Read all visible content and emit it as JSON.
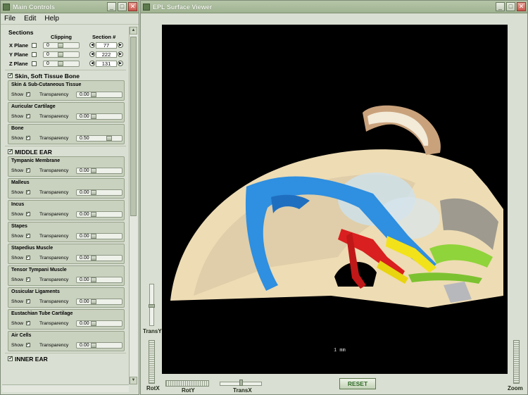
{
  "main_window": {
    "title": "Main Controls",
    "controls": {
      "minimize": "_",
      "maximize": "□",
      "close": "✕"
    },
    "menu": [
      "File",
      "Edit",
      "Help"
    ],
    "sections": {
      "header": "Sections",
      "col_clipping": "Clipping",
      "col_section": "Section #",
      "planes": [
        {
          "label": "X Plane",
          "clip": "0",
          "section": "77"
        },
        {
          "label": "Y Plane",
          "clip": "0",
          "section": "222"
        },
        {
          "label": "Z Plane",
          "clip": "0",
          "section": "131"
        }
      ]
    },
    "show_label": "Show",
    "transparency_label": "Transparency",
    "groups": [
      {
        "label": "Skin, Soft Tissue  Bone",
        "items": [
          {
            "name": "Skin & Sub-Cutaneous Tissue",
            "transparency": "0.00",
            "level": 0.0
          },
          {
            "name": "Auricular Cartilage",
            "transparency": "0.00",
            "level": 0.0
          },
          {
            "name": "Bone",
            "transparency": "0.50",
            "level": 0.5
          }
        ]
      },
      {
        "label": "MIDDLE EAR",
        "items": [
          {
            "name": "Tympanic Membrane",
            "transparency": "0.00",
            "level": 0.0
          },
          {
            "name": "Malleus",
            "transparency": "0.00",
            "level": 0.0
          },
          {
            "name": "Incus",
            "transparency": "0.00",
            "level": 0.0
          },
          {
            "name": "Stapes",
            "transparency": "0.00",
            "level": 0.0
          },
          {
            "name": "Stapedius Muscle",
            "transparency": "0.00",
            "level": 0.0
          },
          {
            "name": "Tensor Tympani Muscle",
            "transparency": "0.00",
            "level": 0.0
          },
          {
            "name": "Ossicular Ligaments",
            "transparency": "0.00",
            "level": 0.0
          },
          {
            "name": "Eustachian Tube Cartilage",
            "transparency": "0.00",
            "level": 0.0
          },
          {
            "name": "Air Cells",
            "transparency": "0.00",
            "level": 0.0
          }
        ]
      },
      {
        "label": "INNER EAR",
        "items": []
      }
    ]
  },
  "viewer_window": {
    "title": "EPL Surface Viewer",
    "controls": {
      "minimize": "_",
      "maximize": "□",
      "close": "✕"
    },
    "scale_text": "1 mm",
    "labels": {
      "transy": "TransY",
      "rotx": "RotX",
      "roty": "RotY",
      "transx": "TransX",
      "zoom": "Zoom"
    },
    "reset": "RESET"
  },
  "colors": {
    "accent_green": "#2f6a24",
    "bone": "#e9d4a8",
    "tympanic": "#2f8fe0",
    "malleus": "#d91f1f",
    "incus": "#f2e21a",
    "stapes": "#8fd43a"
  }
}
